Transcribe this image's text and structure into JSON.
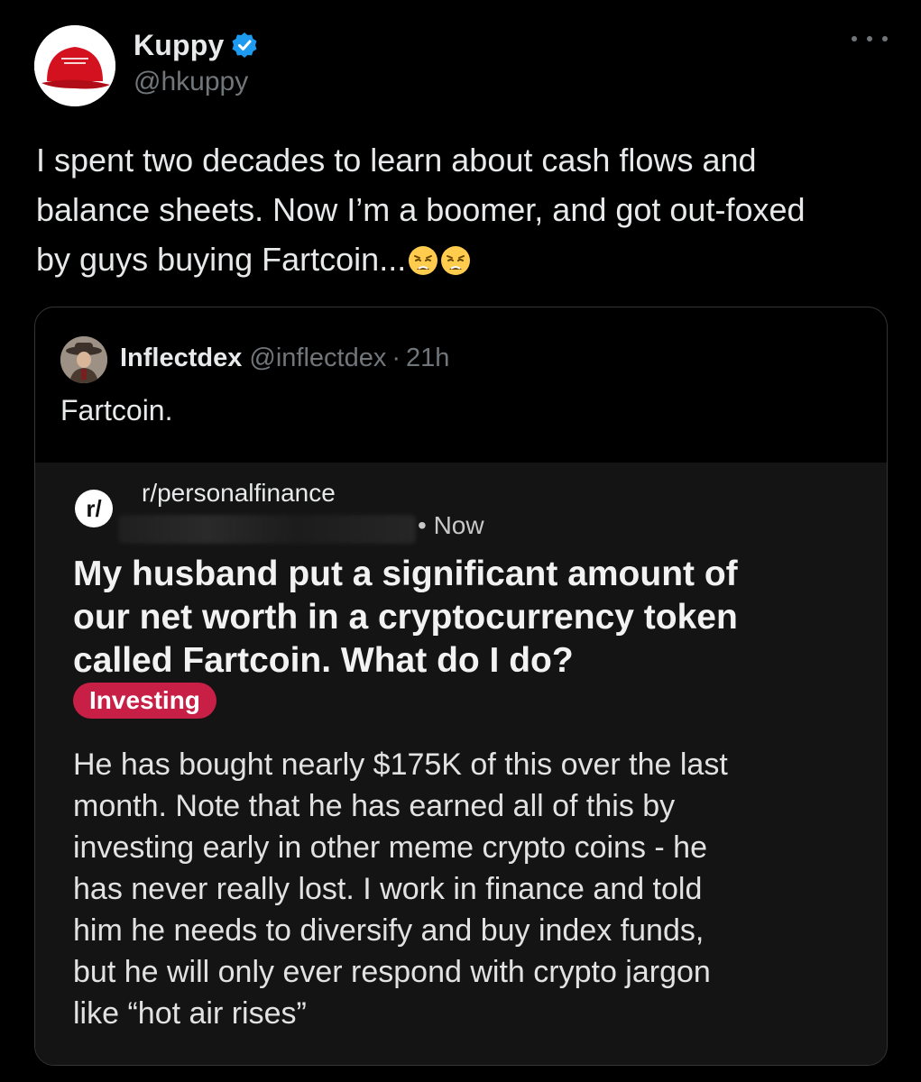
{
  "author": {
    "display_name": "Kuppy",
    "handle": "@hkuppy",
    "verified_icon": "verified-badge-icon",
    "avatar_icon": "red-cap-avatar",
    "accent_color": "#1d9bf0"
  },
  "tweet": {
    "lines": [
      "I spent two decades to learn about cash flows and",
      "balance sheets. Now I’m a boomer, and got out-foxed",
      "by guys buying Fartcoin..."
    ],
    "emoji": "weary-face-emoji"
  },
  "quoted": {
    "display_name": "Inflectdex",
    "handle": "@inflectdex",
    "separator": "·",
    "time": "21h",
    "text": "Fartcoin."
  },
  "reddit_post": {
    "icon_label": "r/",
    "subreddit": "r/personalfinance",
    "meta": "• Now",
    "title_lines": [
      "My husband put a significant amount of",
      "our net worth in a cryptocurrency token",
      "called Fartcoin. What do I do?"
    ],
    "flair": "Investing",
    "flair_color": "#c71f46",
    "body_lines": [
      "He has bought nearly $175K of this over the last",
      "month. Note that he has earned all of this by",
      "investing early in other meme crypto coins - he",
      "has never really lost. I work in finance and told",
      "him he needs to diversify and buy index funds,",
      "but he will only ever respond with crypto jargon",
      "like “hot air rises”"
    ]
  }
}
